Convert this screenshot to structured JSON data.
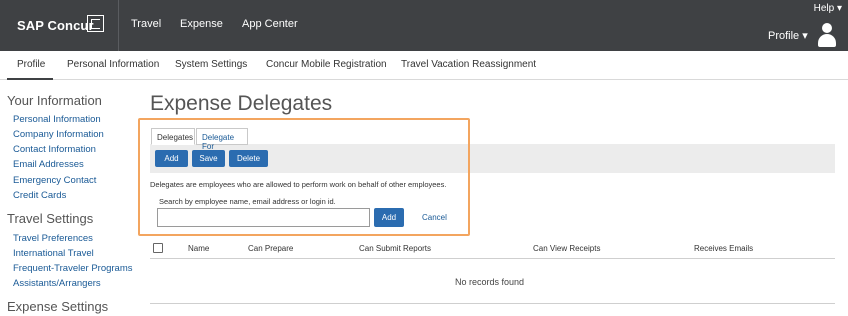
{
  "brand": {
    "name": "SAP Concur"
  },
  "topnav": {
    "items": [
      "Travel",
      "Expense",
      "App Center"
    ]
  },
  "header": {
    "help_label": "Help ▾",
    "profile_label": "Profile ▾"
  },
  "subnav": {
    "items": [
      "Profile",
      "Personal Information",
      "System Settings",
      "Concur Mobile Registration",
      "Travel Vacation Reassignment"
    ],
    "active": "Profile"
  },
  "sidebar": {
    "your_information": {
      "heading": "Your Information",
      "links": [
        "Personal Information",
        "Company Information",
        "Contact Information",
        "Email Addresses",
        "Emergency Contact",
        "Credit Cards"
      ]
    },
    "travel_settings": {
      "heading": "Travel Settings",
      "links": [
        "Travel Preferences",
        "International Travel",
        "Frequent-Traveler Programs",
        "Assistants/Arrangers"
      ]
    },
    "expense_settings": {
      "heading": "Expense Settings"
    }
  },
  "main": {
    "title": "Expense Delegates",
    "tabs": [
      "Delegates",
      "Delegate For"
    ],
    "buttons": {
      "add": "Add",
      "save": "Save",
      "delete": "Delete"
    },
    "info_text": "Delegates are employees who are allowed to perform work on behalf of other employees.",
    "search": {
      "label": "Search by employee name, email address or login id.",
      "value": "",
      "placeholder": "",
      "add_label": "Add",
      "cancel_label": "Cancel"
    },
    "table": {
      "columns": [
        "Name",
        "Can Prepare",
        "Can Submit Reports",
        "Can View Receipts",
        "Receives Emails"
      ],
      "empty_message": "No records found"
    }
  },
  "colors": {
    "topbar": "#3f4144",
    "primary_button": "#2b6cb0",
    "link": "#1a5a96",
    "highlight": "#f3a55f"
  }
}
